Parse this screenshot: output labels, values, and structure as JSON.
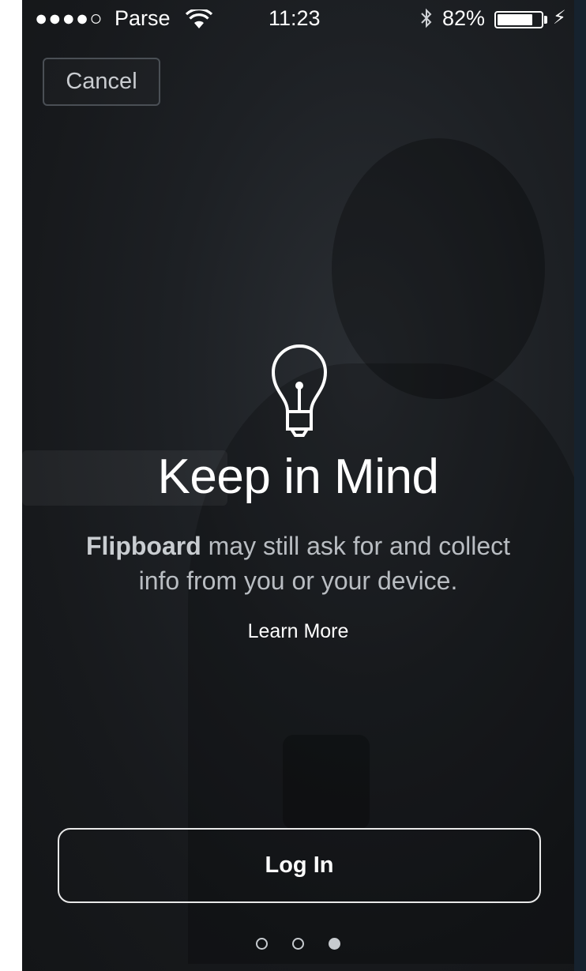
{
  "status_bar": {
    "signal": "●●●●○",
    "carrier": "Parse",
    "time": "11:23",
    "bluetooth_icon": "bluetooth-icon",
    "battery_percent": "82%",
    "battery_level": 0.82,
    "wifi_icon": "wifi-icon",
    "charging_icon": "⚡"
  },
  "header": {
    "cancel_label": "Cancel"
  },
  "main": {
    "icon": "lightbulb-icon",
    "title": "Keep in Mind",
    "description_brand": "Flipboard",
    "description_rest": " may still ask for and collect",
    "description_line2": "info from you or your device.",
    "learn_more_label": "Learn More"
  },
  "footer": {
    "login_label": "Log In",
    "page_indicator": {
      "total": 3,
      "active_index": 2
    }
  },
  "colors": {
    "background": "#1b1e22",
    "text": "#ffffff",
    "muted_text": "#b9bdc2",
    "frame_accent": "#1f5fa6"
  }
}
